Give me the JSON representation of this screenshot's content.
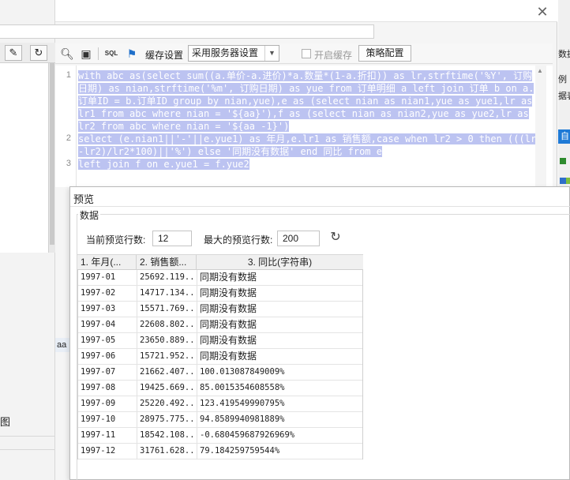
{
  "background": {
    "bottom_left_label": "图",
    "side_tag": "aa",
    "right_strip": {
      "item_1": "数据",
      "item_2": "例",
      "item_3": "据表",
      "blue_tag": "自"
    }
  },
  "sql_dialog": {
    "close_icon": "✕",
    "toolbar": {
      "cache_settings_label": "缓存设置",
      "cache_select_value": "采用服务器设置",
      "enable_cache_label": "开启缓存",
      "policy_button": "策略配置"
    },
    "editor": {
      "line_numbers": [
        "1",
        "2",
        "3"
      ],
      "lines": [
        "with abc as(select sum((a.单价-a.进价)*a.数量*(1-a.折扣)) as lr,strftime('%Y', 订购",
        "日期) as nian,strftime('%m', 订购日期) as yue from 订单明细 a left join 订单 b on a.",
        "订单ID = b.订单ID group by nian,yue),e as (select nian as nian1,yue as yue1,lr as",
        "lr1 from abc where nian = '${aa}'),f as (select nian as nian2,yue as yue2,lr as",
        "lr2 from abc where nian = '${aa -1}')",
        "select (e.nian1||'-'||e.yue1) as 年月,e.lr1 as 销售额,case when lr2 > 0 then (((lr1",
        "-lr2)/lr2*100)||'%') else '同期没有数据' end 同比 from e",
        "left join f on e.yue1 = f.yue2"
      ]
    }
  },
  "preview": {
    "title": "预览",
    "group_label": "数据",
    "current_rows_label": "当前预览行数:",
    "current_rows_value": "12",
    "max_rows_label": "最大的预览行数:",
    "max_rows_value": "200",
    "refresh_icon": "refresh-icon",
    "columns": [
      "1. 年月(...",
      "2. 销售额...",
      "3. 同比(字符串)"
    ],
    "rows": [
      [
        "1997-01",
        "25692.119...",
        "同期没有数据"
      ],
      [
        "1997-02",
        "14717.134...",
        "同期没有数据"
      ],
      [
        "1997-03",
        "15571.769...",
        "同期没有数据"
      ],
      [
        "1997-04",
        "22608.802...",
        "同期没有数据"
      ],
      [
        "1997-05",
        "23650.889...",
        "同期没有数据"
      ],
      [
        "1997-06",
        "15721.952...",
        "同期没有数据"
      ],
      [
        "1997-07",
        "21662.407...",
        "100.013087849009%"
      ],
      [
        "1997-08",
        "19425.669...",
        "85.0015354608558%"
      ],
      [
        "1997-09",
        "25220.492...",
        "123.419549990795%"
      ],
      [
        "1997-10",
        "28975.775...",
        "94.8589940981889%"
      ],
      [
        "1997-11",
        "18542.108...",
        "-0.680459687926969%"
      ],
      [
        "1997-12",
        "31761.628...",
        "79.184259759544%"
      ]
    ]
  }
}
